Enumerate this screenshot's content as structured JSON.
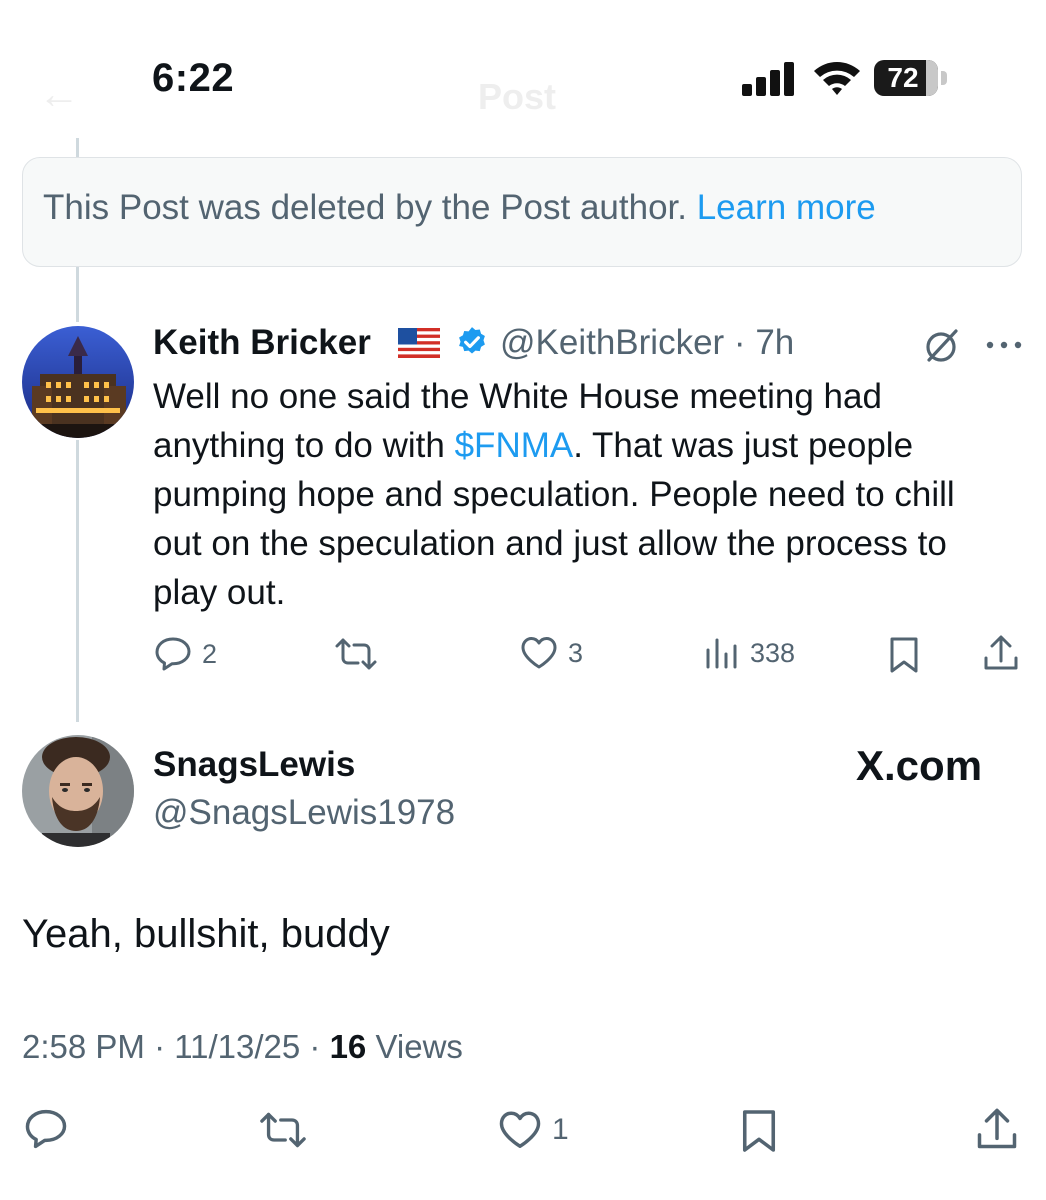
{
  "status_bar": {
    "time": "6:22",
    "battery": "72"
  },
  "ghost_header": {
    "title": "Post"
  },
  "deleted_notice": {
    "text": "This Post was deleted by the Post author.",
    "link": "Learn more"
  },
  "post": {
    "author_name": "Keith Bricker",
    "handle": "@KeithBricker",
    "time": "7h",
    "text_before": "Well no one said the White House meeting had anything to do with ",
    "cashtag": "$FNMA",
    "text_after": ". That was just people pumping hope and speculation. People need to chill out on the speculation and just allow the process to play out.",
    "replies": "2",
    "likes": "3",
    "views": "338"
  },
  "reply": {
    "author_name": "SnagsLewis",
    "handle": "@SnagsLewis1978",
    "text": "Yeah, bullshit, buddy",
    "time": "2:58 PM",
    "date": "11/13/25",
    "views_count": "16",
    "views_label": "Views",
    "likes": "1"
  },
  "watermark": "X.com",
  "icons": {
    "signal": "cellular-signal-icon",
    "wifi": "wifi-icon",
    "battery": "battery-icon",
    "verified": "verified-badge-icon",
    "flag": "us-flag-icon",
    "grok": "grok-icon",
    "more": "more-options-icon",
    "reply": "reply-icon",
    "repost": "repost-icon",
    "like": "like-icon",
    "views": "views-icon",
    "bookmark": "bookmark-icon",
    "share": "share-icon"
  },
  "colors": {
    "link": "#1d9bf0",
    "secondary_text": "#536471",
    "verified": "#1d9bf0"
  }
}
